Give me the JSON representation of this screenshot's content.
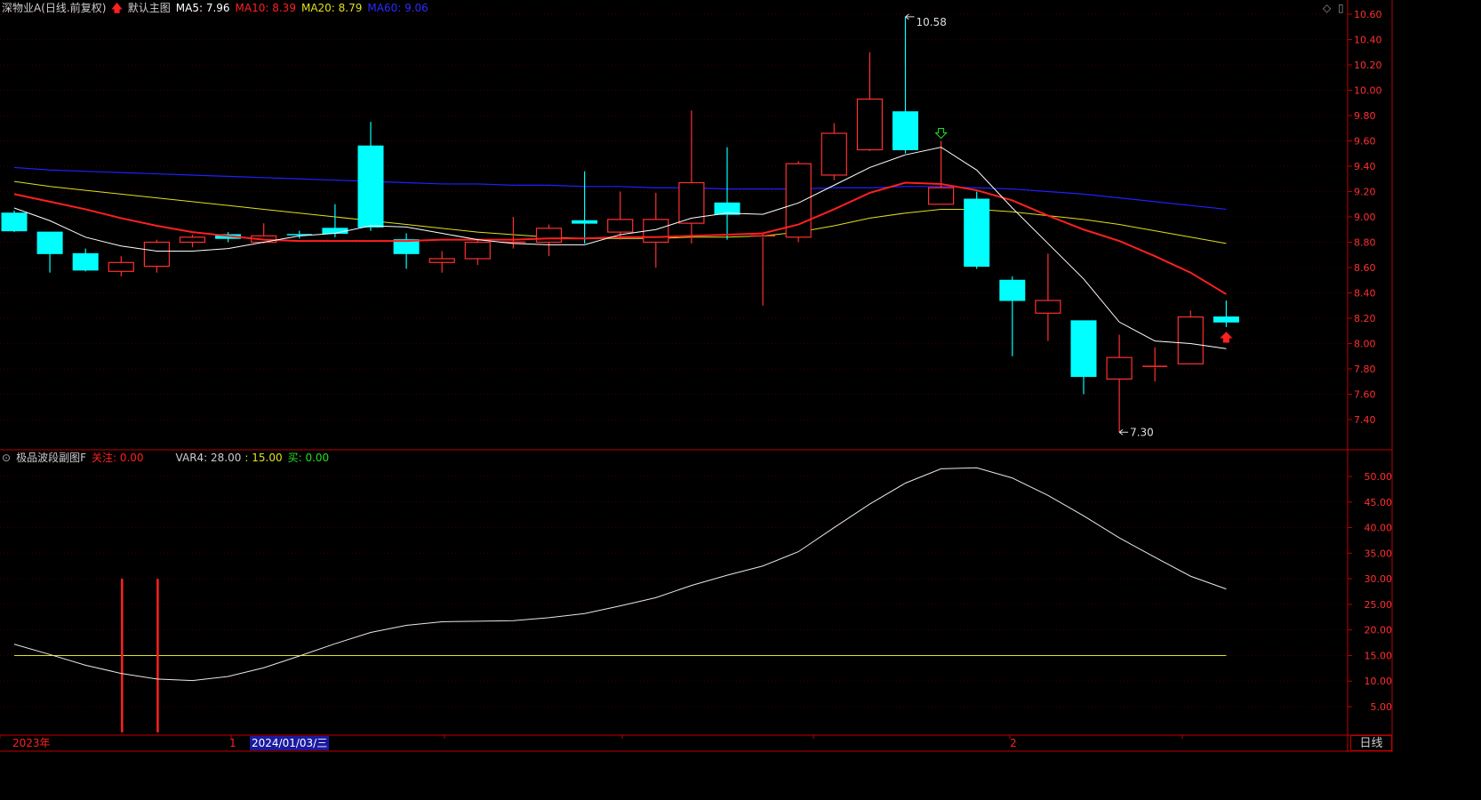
{
  "main_header": {
    "stock": "深物业A",
    "mode": "(日线.前复权)",
    "template": "默认主图",
    "ma5": "MA5: 7.96",
    "ma10": "MA10: 8.39",
    "ma20": "MA20: 8.79",
    "ma60": "MA60: 9.06"
  },
  "sub_header": {
    "name": "极品波段副图F",
    "guanzhu": "关注: 0.00",
    "var4": "VAR4: 28.00",
    "var4b": ": 15.00",
    "mai": "买: 0.00"
  },
  "bottom_bar": {
    "year": "2023年",
    "mark1": "1",
    "date": "2024/01/03/三",
    "mark2": "2",
    "period_button": "日线"
  },
  "annotations": {
    "high": "10.58",
    "low": "7.30"
  },
  "colors": {
    "up": "#ff3030",
    "down": "#00ffff",
    "ma5": "#ffffff",
    "ma10": "#ff2020",
    "ma20": "#e0e020",
    "ma60": "#2020ff",
    "axis": "#c00000"
  },
  "chart_data": [
    {
      "type": "candlestick",
      "title": "深物业A (日线.前复权)",
      "y_ticks": [
        7.4,
        7.6,
        7.8,
        8.0,
        8.2,
        8.4,
        8.6,
        8.8,
        9.0,
        9.2,
        9.4,
        9.6,
        9.8,
        10.0,
        10.2,
        10.4,
        10.6
      ],
      "ylim": [
        7.2,
        10.7
      ],
      "candles": [
        {
          "o": 9.03,
          "h": 9.05,
          "l": 8.88,
          "c": 8.89
        },
        {
          "o": 8.88,
          "h": 8.88,
          "l": 8.56,
          "c": 8.71
        },
        {
          "o": 8.71,
          "h": 8.75,
          "l": 8.57,
          "c": 8.58
        },
        {
          "o": 8.57,
          "h": 8.69,
          "l": 8.53,
          "c": 8.64
        },
        {
          "o": 8.61,
          "h": 8.82,
          "l": 8.56,
          "c": 8.8
        },
        {
          "o": 8.8,
          "h": 8.86,
          "l": 8.76,
          "c": 8.84
        },
        {
          "o": 8.86,
          "h": 8.88,
          "l": 8.8,
          "c": 8.83
        },
        {
          "o": 8.8,
          "h": 8.95,
          "l": 8.79,
          "c": 8.85
        },
        {
          "o": 8.86,
          "h": 8.89,
          "l": 8.83,
          "c": 8.85
        },
        {
          "o": 8.91,
          "h": 9.1,
          "l": 8.84,
          "c": 8.87
        },
        {
          "o": 9.56,
          "h": 9.75,
          "l": 8.89,
          "c": 8.92
        },
        {
          "o": 8.82,
          "h": 8.87,
          "l": 8.59,
          "c": 8.71
        },
        {
          "o": 8.64,
          "h": 8.73,
          "l": 8.56,
          "c": 8.67
        },
        {
          "o": 8.67,
          "h": 8.83,
          "l": 8.62,
          "c": 8.8
        },
        {
          "o": 8.79,
          "h": 9.0,
          "l": 8.75,
          "c": 8.8
        },
        {
          "o": 8.8,
          "h": 8.94,
          "l": 8.69,
          "c": 8.91
        },
        {
          "o": 8.97,
          "h": 9.36,
          "l": 8.79,
          "c": 8.95
        },
        {
          "o": 8.88,
          "h": 9.2,
          "l": 8.82,
          "c": 8.98
        },
        {
          "o": 8.8,
          "h": 9.19,
          "l": 8.6,
          "c": 8.98
        },
        {
          "o": 8.95,
          "h": 9.84,
          "l": 8.79,
          "c": 9.27
        },
        {
          "o": 9.11,
          "h": 9.55,
          "l": 8.82,
          "c": 9.02
        },
        {
          "o": 8.85,
          "h": 8.87,
          "l": 8.3,
          "c": 8.85
        },
        {
          "o": 8.84,
          "h": 9.44,
          "l": 8.8,
          "c": 9.42
        },
        {
          "o": 9.33,
          "h": 9.74,
          "l": 9.29,
          "c": 9.66
        },
        {
          "o": 9.53,
          "h": 10.3,
          "l": 9.52,
          "c": 9.93
        },
        {
          "o": 9.83,
          "h": 10.58,
          "l": 9.5,
          "c": 9.53
        },
        {
          "o": 9.1,
          "h": 9.6,
          "l": 9.1,
          "c": 9.23
        },
        {
          "o": 9.14,
          "h": 9.2,
          "l": 8.59,
          "c": 8.61
        },
        {
          "o": 8.5,
          "h": 8.53,
          "l": 7.9,
          "c": 8.34
        },
        {
          "o": 8.24,
          "h": 8.71,
          "l": 8.02,
          "c": 8.34
        },
        {
          "o": 8.18,
          "h": 8.18,
          "l": 7.6,
          "c": 7.74
        },
        {
          "o": 7.72,
          "h": 8.07,
          "l": 7.3,
          "c": 7.89
        },
        {
          "o": 7.82,
          "h": 7.97,
          "l": 7.7,
          "c": 7.82
        },
        {
          "o": 7.84,
          "h": 8.26,
          "l": 7.84,
          "c": 8.21
        },
        {
          "o": 8.21,
          "h": 8.34,
          "l": 8.13,
          "c": 8.17
        }
      ],
      "ma5": [
        9.07,
        8.97,
        8.84,
        8.77,
        8.73,
        8.73,
        8.75,
        8.8,
        8.85,
        8.87,
        8.93,
        8.92,
        8.87,
        8.82,
        8.79,
        8.78,
        8.78,
        8.86,
        8.9,
        8.99,
        9.03,
        9.02,
        9.11,
        9.25,
        9.39,
        9.49,
        9.55,
        9.37,
        9.07,
        8.79,
        8.51,
        8.17,
        8.02,
        8.0,
        7.96
      ],
      "ma10": [
        9.18,
        9.12,
        9.06,
        8.99,
        8.93,
        8.88,
        8.85,
        8.82,
        8.81,
        8.81,
        8.81,
        8.81,
        8.82,
        8.82,
        8.82,
        8.83,
        8.83,
        8.84,
        8.84,
        8.85,
        8.86,
        8.87,
        8.94,
        9.06,
        9.19,
        9.27,
        9.26,
        9.21,
        9.13,
        9.01,
        8.9,
        8.81,
        8.69,
        8.56,
        8.39
      ],
      "ma20": [
        9.28,
        9.24,
        9.21,
        9.18,
        9.15,
        9.12,
        9.09,
        9.06,
        9.03,
        9.0,
        8.97,
        8.94,
        8.91,
        8.88,
        8.86,
        8.84,
        8.83,
        8.83,
        8.83,
        8.84,
        8.84,
        8.85,
        8.88,
        8.93,
        8.99,
        9.03,
        9.06,
        9.06,
        9.04,
        9.01,
        8.98,
        8.94,
        8.89,
        8.84,
        8.79
      ],
      "ma60": [
        9.39,
        9.37,
        9.36,
        9.35,
        9.34,
        9.33,
        9.32,
        9.31,
        9.3,
        9.29,
        9.28,
        9.27,
        9.26,
        9.26,
        9.25,
        9.25,
        9.24,
        9.24,
        9.23,
        9.23,
        9.22,
        9.22,
        9.22,
        9.23,
        9.23,
        9.24,
        9.24,
        9.23,
        9.22,
        9.2,
        9.18,
        9.15,
        9.12,
        9.09,
        9.06
      ],
      "signals": [
        {
          "index": 26,
          "kind": "sell-arrow"
        },
        {
          "index": 34,
          "kind": "buy-arrow"
        }
      ]
    },
    {
      "type": "line",
      "title": "极品波段副图F",
      "y_ticks": [
        5,
        10,
        15,
        20,
        25,
        30,
        35,
        40,
        45,
        50
      ],
      "y_tick_labels": [
        "5.00",
        "10.00",
        "15.00",
        "20.00",
        "25.00",
        "30.00",
        "35.00",
        "40.00",
        "45.00",
        "50.00"
      ],
      "ylim": [
        0,
        55
      ],
      "var4": [
        17.2,
        15.2,
        13.1,
        11.5,
        10.4,
        10.1,
        10.9,
        12.6,
        14.9,
        17.3,
        19.5,
        20.9,
        21.6,
        21.7,
        21.8,
        22.4,
        23.2,
        24.7,
        26.3,
        28.7,
        30.7,
        32.5,
        35.3,
        40.0,
        44.6,
        48.7,
        51.5,
        51.7,
        49.7,
        46.3,
        42.3,
        38.0,
        34.2,
        30.5,
        28.0
      ],
      "reference_line": 15,
      "bars": [
        {
          "index": 3,
          "value": 30
        },
        {
          "index": 4,
          "value": 30
        }
      ]
    }
  ]
}
